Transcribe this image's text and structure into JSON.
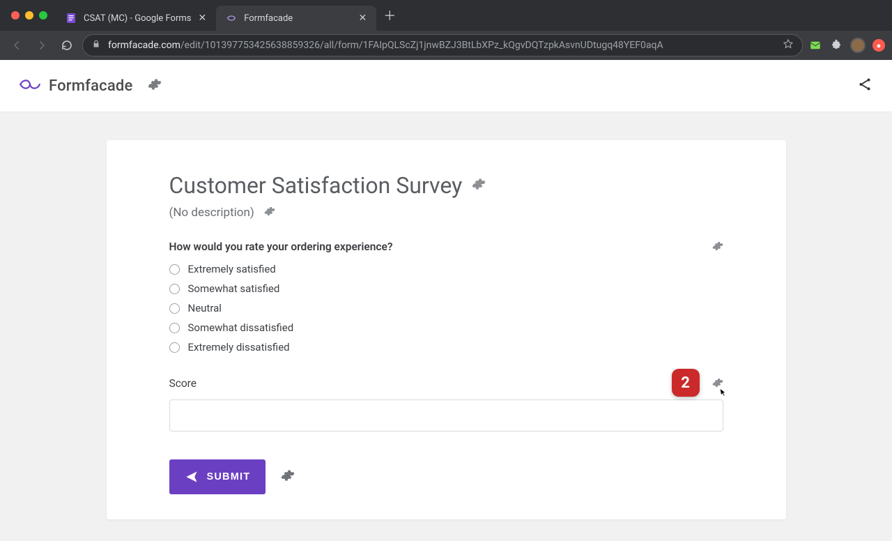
{
  "browser": {
    "tabs": [
      {
        "title": "CSAT (MC) - Google Forms",
        "active": false
      },
      {
        "title": "Formfacade",
        "active": true
      }
    ],
    "url_host": "formfacade.com",
    "url_path": "/edit/101397753425638859326/all/form/1FAIpQLScZj1jnwBZJ3BtLbXPz_kQgvDQTzpkAsvnUDtugq48YEF0aqA"
  },
  "app": {
    "brand": "Formfacade"
  },
  "form": {
    "title": "Customer Satisfaction Survey",
    "description": "(No description)",
    "q1": {
      "label": "How would you rate your ordering experience?",
      "options": [
        "Extremely satisfied",
        "Somewhat satisfied",
        "Neutral",
        "Somewhat dissatisfied",
        "Extremely dissatisfied"
      ]
    },
    "score": {
      "label": "Score",
      "value": "",
      "placeholder": ""
    },
    "submit_label": "SUBMIT",
    "badge_value": "2"
  }
}
